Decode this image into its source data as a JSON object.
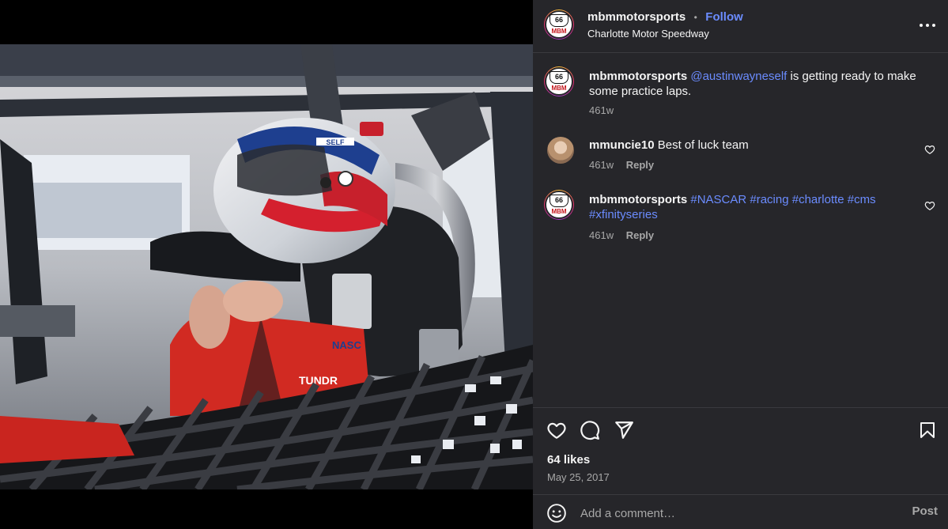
{
  "post": {
    "username": "mbmmotorsports",
    "follow_label": "Follow",
    "separator": "•",
    "location": "Charlotte Motor Speedway",
    "avatar_logo_top": "66",
    "avatar_logo_bottom": "MBM"
  },
  "photo": {
    "suit_text_1": "NASC",
    "suit_text_2": "TUNDR",
    "helmet_text": "SELF"
  },
  "comments": [
    {
      "username": "mbmmotorsports",
      "mention": "@austinwayneself",
      "text": " is getting ready to make some practice laps.",
      "time": "461w"
    },
    {
      "username": "mmuncie10",
      "text": "Best of luck team",
      "time": "461w",
      "reply_label": "Reply"
    },
    {
      "username": "mbmmotorsports",
      "tags": "#NASCAR #racing #charlotte #cms #xfinityseries",
      "time": "461w",
      "reply_label": "Reply"
    }
  ],
  "actions": {
    "likes": "64 likes",
    "date": "May 25, 2017",
    "icons": [
      "heart-icon",
      "comment-icon",
      "share-icon",
      "bookmark-icon"
    ]
  },
  "add_comment": {
    "placeholder": "Add a comment…",
    "post_label": "Post"
  },
  "colors": {
    "panel_bg": "#26262a",
    "link": "#6b8cff",
    "muted": "#a8a8a8"
  }
}
